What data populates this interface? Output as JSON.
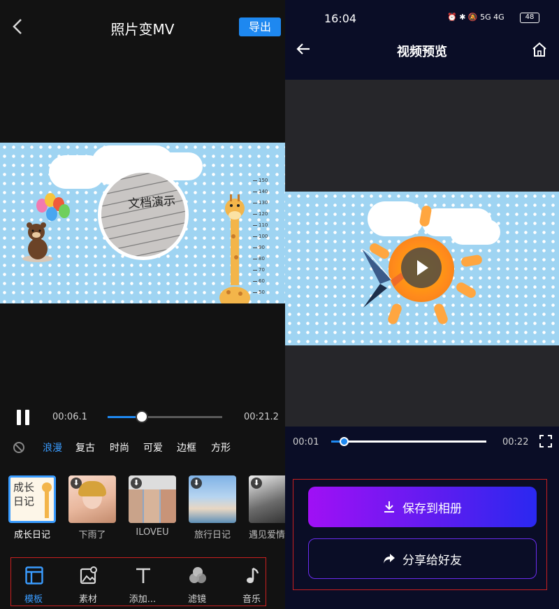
{
  "left": {
    "back_icon": "chevron-left-icon",
    "title": "照片变MV",
    "export_label": "导出",
    "canvas": {
      "photo_caption": "文档演示",
      "ruler_ticks": [
        "150",
        "140",
        "130",
        "120",
        "110",
        "100",
        "90",
        "80",
        "70",
        "60",
        "50"
      ]
    },
    "player": {
      "current_time": "00:06.1",
      "total_time": "00:21.2",
      "progress": 0.3
    },
    "filters": [
      {
        "label": "浪漫",
        "active": true
      },
      {
        "label": "复古",
        "active": false
      },
      {
        "label": "时尚",
        "active": false
      },
      {
        "label": "可爱",
        "active": false
      },
      {
        "label": "边框",
        "active": false
      },
      {
        "label": "方形",
        "active": false
      }
    ],
    "templates": [
      {
        "label": "成长日记",
        "thumb_text": "成长日记",
        "active": true
      },
      {
        "label": "下雨了",
        "active": false
      },
      {
        "label": "ILOVEU",
        "active": false
      },
      {
        "label": "旅行日记",
        "active": false
      },
      {
        "label": "遇见爱情",
        "active": false
      }
    ],
    "tabs": [
      {
        "label": "模板",
        "icon": "template-icon",
        "active": true
      },
      {
        "label": "素材",
        "icon": "material-icon",
        "active": false
      },
      {
        "label": "添加...",
        "icon": "text-icon",
        "active": false
      },
      {
        "label": "滤镜",
        "icon": "filter-icon",
        "active": false
      },
      {
        "label": "音乐",
        "icon": "music-icon",
        "active": false
      }
    ]
  },
  "right": {
    "status": {
      "time": "16:04",
      "icons_text": "⏰ ✱ 🔕 5G 4G",
      "battery": "48"
    },
    "back_icon": "arrow-left-icon",
    "title": "视频预览",
    "home_icon": "home-icon",
    "player": {
      "current_time": "00:01",
      "total_time": "00:22",
      "progress": 0.08
    },
    "save_label": "保存到相册",
    "share_label": "分享给好友"
  },
  "colors": {
    "accent": "#1e88f0",
    "active_blue": "#3a9cff",
    "save_gradient_start": "#a010f5",
    "save_gradient_end": "#2a28f0",
    "highlight_border": "#c82020"
  }
}
